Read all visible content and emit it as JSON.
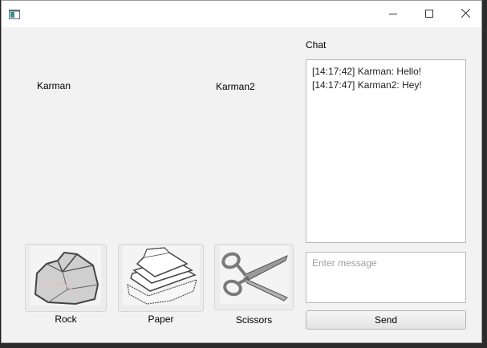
{
  "window": {
    "icon": "app-window-icon"
  },
  "controls": {
    "minimize_icon": "minimize-icon",
    "maximize_icon": "maximize-icon",
    "close_icon": "close-icon"
  },
  "players": {
    "left": "Karman",
    "right": "Karman2"
  },
  "choices": [
    {
      "label": "Rock",
      "icon": "rock-icon"
    },
    {
      "label": "Paper",
      "icon": "paper-icon"
    },
    {
      "label": "Scissors",
      "icon": "scissors-icon"
    }
  ],
  "chat": {
    "title": "Chat",
    "messages": [
      "[14:17:42] Karman: Hello!",
      "[14:17:47] Karman2: Hey!"
    ],
    "input_placeholder": "Enter message",
    "input_value": "",
    "send_label": "Send"
  }
}
